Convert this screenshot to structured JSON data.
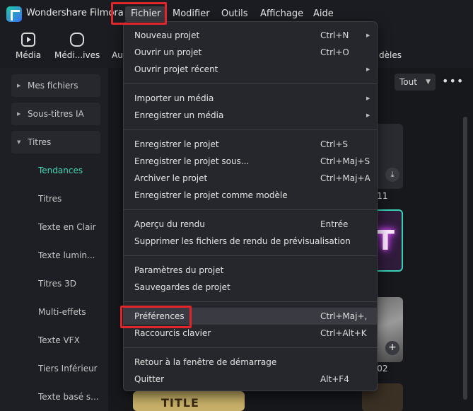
{
  "app": {
    "name": "Wondershare Filmora"
  },
  "menubar": [
    "Fichier",
    "Modifier",
    "Outils",
    "Affichage",
    "Aide"
  ],
  "toolbar": {
    "media": "Média",
    "media_cloud": "Médi...ives",
    "audio": "Au",
    "models": "dèles"
  },
  "sidebar": {
    "groups": [
      "Mes fichiers",
      "Sous-titres IA",
      "Titres"
    ],
    "subitems": [
      "Tendances",
      "Titres",
      "Texte en Clair",
      "Texte lumin...",
      "Titres 3D",
      "Multi-effets",
      "Texte VFX",
      "Tiers Inférieur",
      "Texte basé s..."
    ]
  },
  "filter": {
    "label": "Tout"
  },
  "cards": {
    "label1": "e 11",
    "label2": "e 02",
    "thumb5_text": "TITLE"
  },
  "fichier_menu": {
    "sections": [
      [
        {
          "label": "Nouveau projet",
          "shortcut": "Ctrl+N",
          "submenu": true
        },
        {
          "label": "Ouvrir un projet",
          "shortcut": "Ctrl+O",
          "submenu": false
        },
        {
          "label": "Ouvrir projet récent",
          "shortcut": "",
          "submenu": true
        }
      ],
      [
        {
          "label": "Importer un média",
          "shortcut": "",
          "submenu": true
        },
        {
          "label": "Enregistrer un média",
          "shortcut": "",
          "submenu": true
        }
      ],
      [
        {
          "label": "Enregistrer le projet",
          "shortcut": "Ctrl+S",
          "submenu": false
        },
        {
          "label": "Enregistrer le projet sous...",
          "shortcut": "Ctrl+Maj+S",
          "submenu": false
        },
        {
          "label": "Archiver le projet",
          "shortcut": "Ctrl+Maj+A",
          "submenu": false
        },
        {
          "label": "Enregistrer le projet comme modèle",
          "shortcut": "",
          "submenu": false
        }
      ],
      [
        {
          "label": "Aperçu du rendu",
          "shortcut": "Entrée",
          "submenu": false
        },
        {
          "label": "Supprimer les fichiers de rendu de prévisualisation",
          "shortcut": "",
          "submenu": false
        }
      ],
      [
        {
          "label": "Paramètres du projet",
          "shortcut": "",
          "submenu": false
        },
        {
          "label": "Sauvegardes de projet",
          "shortcut": "",
          "submenu": false
        }
      ],
      [
        {
          "label": "Préférences",
          "shortcut": "Ctrl+Maj+,",
          "submenu": false,
          "highlighted": true
        },
        {
          "label": "Raccourcis clavier",
          "shortcut": "Ctrl+Alt+K",
          "submenu": false
        }
      ],
      [
        {
          "label": "Retour à la fenêtre de démarrage",
          "shortcut": "",
          "submenu": false
        },
        {
          "label": "Quitter",
          "shortcut": "Alt+F4",
          "submenu": false
        }
      ]
    ]
  },
  "colors": {
    "accent": "#3ed8b4",
    "highlight_box": "#e0262a",
    "menu_bg": "#26272c",
    "app_bg": "#17181c"
  }
}
